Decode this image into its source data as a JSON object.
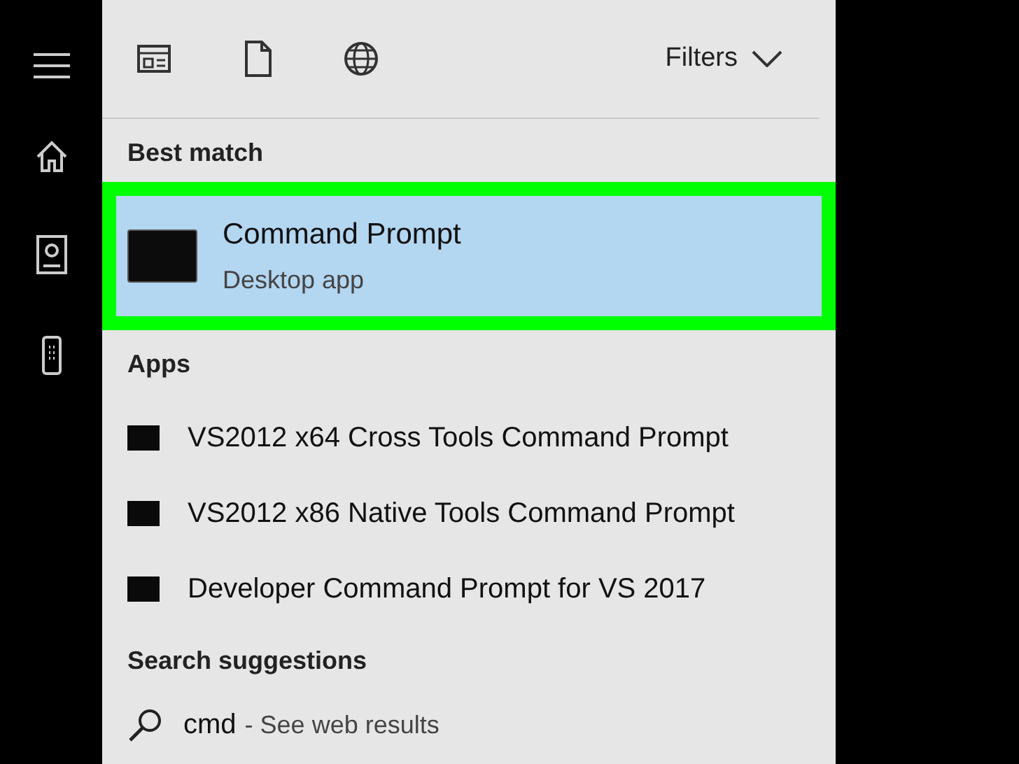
{
  "toolbar": {
    "filters": {
      "label": "Filters",
      "expanded": false
    }
  },
  "best_match": {
    "header": "Best match",
    "item": {
      "title": "Command Prompt",
      "subtitle": "Desktop app",
      "selected": true
    }
  },
  "apps": {
    "header": "Apps",
    "items": [
      {
        "title": "VS2012 x64 Cross Tools Command Prompt"
      },
      {
        "title": "VS2012 x86 Native Tools Command Prompt"
      },
      {
        "title": "Developer Command Prompt for VS 2017"
      }
    ]
  },
  "suggestions": {
    "header": "Search suggestions",
    "items": [
      {
        "query": "cmd",
        "hint": "- See web results"
      }
    ]
  }
}
